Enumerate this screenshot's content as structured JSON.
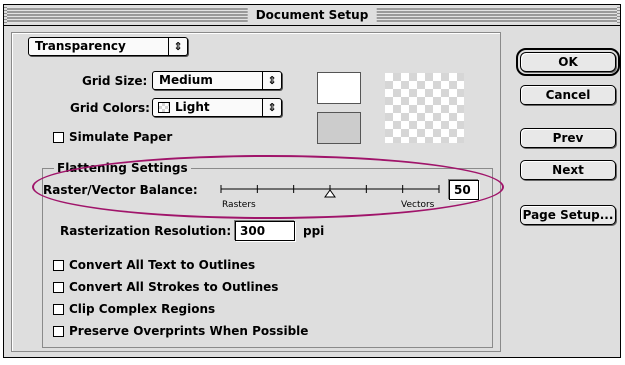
{
  "window": {
    "title": "Document Setup"
  },
  "panel_popup": {
    "value": "Transparency",
    "arrows": "⇕"
  },
  "grid_size": {
    "label": "Grid Size:",
    "value": "Medium",
    "arrows": "⇕"
  },
  "grid_colors": {
    "label": "Grid Colors:",
    "value": "Light",
    "arrows": "⇕"
  },
  "simulate_paper": {
    "label": "Simulate Paper",
    "checked": false
  },
  "flattening": {
    "title": "Flattening Settings",
    "balance": {
      "label": "Raster/Vector Balance:",
      "value": "50",
      "slider_level": 0.5,
      "left_label": "Rasters",
      "right_label": "Vectors"
    },
    "resolution": {
      "label": "Rasterization Resolution:",
      "value": "300",
      "unit": "ppi"
    },
    "options": [
      {
        "label": "Convert All Text to Outlines",
        "checked": false
      },
      {
        "label": "Convert All Strokes to Outlines",
        "checked": false
      },
      {
        "label": "Clip Complex Regions",
        "checked": false
      },
      {
        "label": "Preserve Overprints When Possible",
        "checked": false
      }
    ]
  },
  "buttons": {
    "ok": "OK",
    "cancel": "Cancel",
    "prev": "Prev",
    "next": "Next",
    "page_setup": "Page Setup..."
  },
  "colors": {
    "annotation_ellipse": "#a0146a",
    "dialog_bg": "#dedede"
  }
}
